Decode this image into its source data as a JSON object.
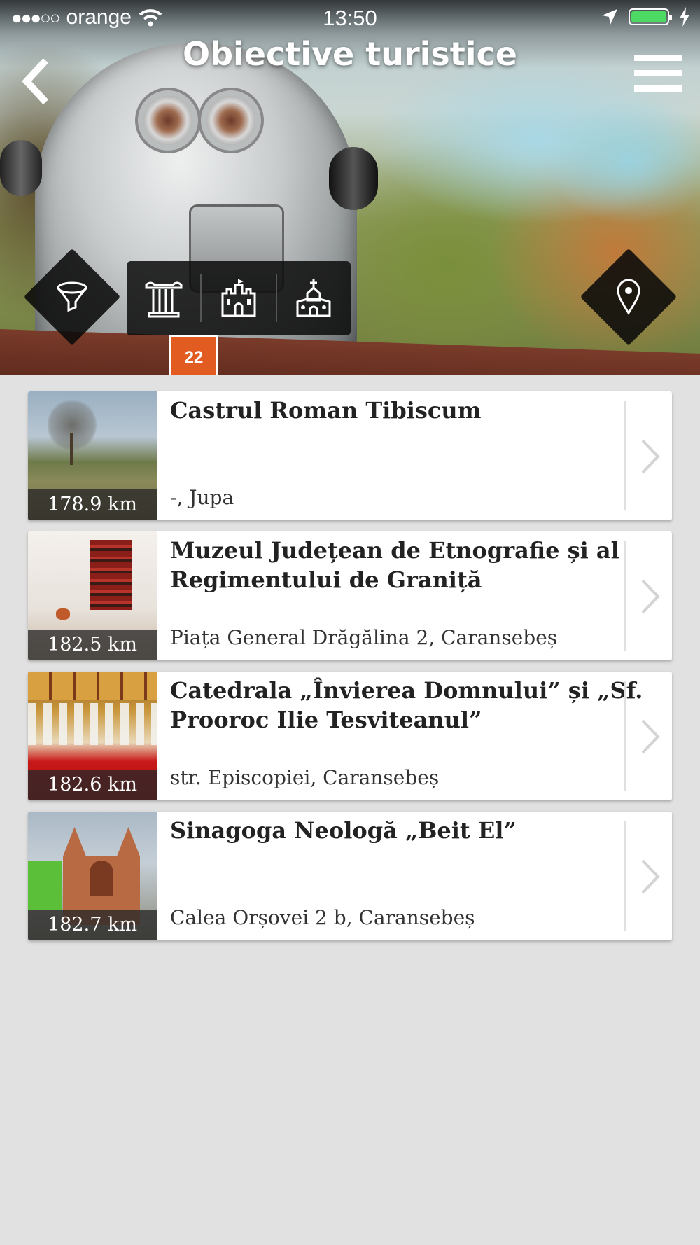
{
  "status_bar": {
    "signal_dots": "●●●○○",
    "carrier": "orange",
    "time": "13:50",
    "battery_level": 1.0
  },
  "header": {
    "title": "Obiective turistice",
    "sign_text": "22"
  },
  "icons": {
    "back": "chevron-left-icon",
    "menu": "hamburger-menu-icon",
    "filter": "funnel-icon",
    "map": "map-pin-icon",
    "categories": [
      "column-icon",
      "castle-icon",
      "church-icon"
    ]
  },
  "colors": {
    "background": "#e1e1e1",
    "battery": "#4cd964",
    "overlay": "#0a0a0a"
  },
  "items": [
    {
      "title": "Castrul Roman Tibiscum",
      "address": "-, Jupa",
      "distance": "178.9 km"
    },
    {
      "title": "Muzeul Județean de Etnografie și al Regimentului de Graniță",
      "address": "Piața General Drăgălina 2, Caransebeș",
      "distance": "182.5 km"
    },
    {
      "title": "Catedrala „Învierea Domnului” și „Sf. Prooroc Ilie Tesviteanul”",
      "address": "str. Episcopiei, Caransebeș",
      "distance": "182.6 km"
    },
    {
      "title": "Sinagoga Neologă „Beit El”",
      "address": "Calea Orșovei 2 b, Caransebeș",
      "distance": "182.7 km"
    }
  ]
}
